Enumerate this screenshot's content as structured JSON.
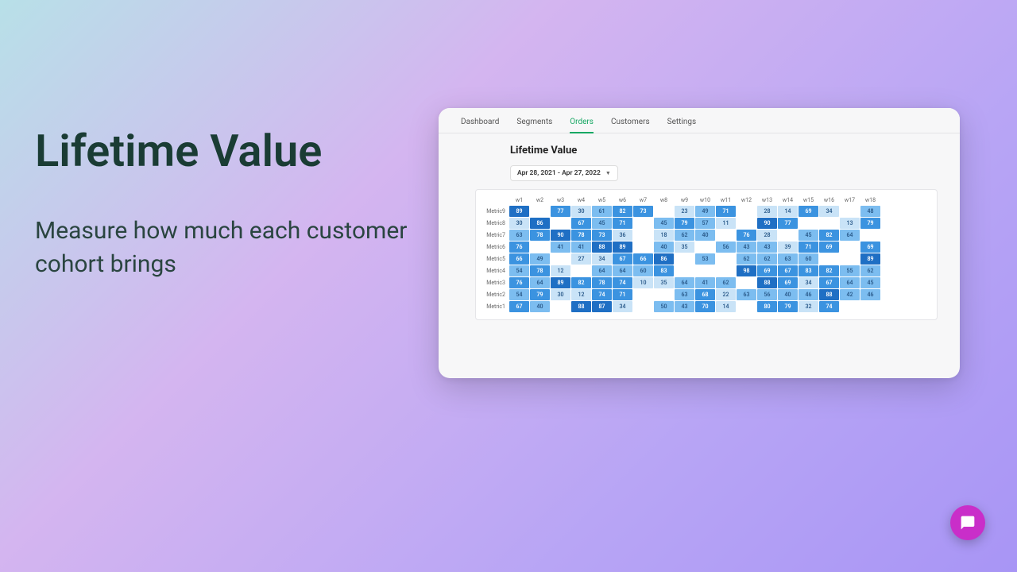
{
  "hero": {
    "title": "Lifetime Value",
    "subtitle": "Measure how much each customer cohort brings"
  },
  "tabs": [
    "Dashboard",
    "Segments",
    "Orders",
    "Customers",
    "Settings"
  ],
  "active_tab_index": 2,
  "page": {
    "title": "Lifetime Value",
    "date_range": "Apr 28, 2021 - Apr 27, 2022"
  },
  "chart_data": {
    "type": "heatmap",
    "title": "Lifetime Value",
    "xlabel": "",
    "ylabel": "",
    "columns": [
      "w1",
      "w2",
      "w3",
      "w4",
      "w5",
      "w6",
      "w7",
      "w8",
      "w9",
      "w10",
      "w11",
      "w12",
      "w13",
      "w14",
      "w15",
      "w16",
      "w17",
      "w18"
    ],
    "rows": [
      "Metric9",
      "Metric8",
      "Metric7",
      "Metric6",
      "Metric5",
      "Metric4",
      "Metric3",
      "Metric2",
      "Metric1"
    ],
    "values": [
      [
        89,
        null,
        77,
        30,
        61,
        82,
        73,
        null,
        23,
        49,
        71,
        null,
        28,
        14,
        69,
        34,
        null,
        48
      ],
      [
        30,
        86,
        null,
        67,
        45,
        71,
        null,
        45,
        79,
        57,
        11,
        null,
        90,
        77,
        null,
        null,
        13,
        79
      ],
      [
        63,
        78,
        90,
        78,
        73,
        36,
        null,
        18,
        62,
        40,
        null,
        76,
        28,
        null,
        45,
        82,
        64,
        null
      ],
      [
        76,
        null,
        41,
        41,
        88,
        89,
        null,
        40,
        35,
        null,
        56,
        43,
        43,
        39,
        71,
        69,
        null,
        69
      ],
      [
        66,
        49,
        null,
        27,
        34,
        67,
        66,
        86,
        null,
        53,
        null,
        62,
        62,
        63,
        60,
        null,
        null,
        89
      ],
      [
        54,
        78,
        12,
        null,
        64,
        64,
        60,
        83,
        null,
        null,
        null,
        98,
        69,
        67,
        83,
        82,
        55,
        62
      ],
      [
        76,
        64,
        89,
        82,
        78,
        74,
        10,
        35,
        64,
        41,
        62,
        null,
        88,
        69,
        34,
        67,
        64,
        45
      ],
      [
        54,
        79,
        30,
        12,
        74,
        71,
        null,
        null,
        63,
        68,
        22,
        63,
        56,
        40,
        46,
        88,
        42,
        46
      ],
      [
        67,
        40,
        null,
        88,
        87,
        34,
        null,
        50,
        43,
        70,
        14,
        null,
        80,
        79,
        32,
        74,
        null,
        null
      ]
    ],
    "color_scale": {
      "null": "#ffffff",
      "low": "#c9e3f7",
      "mid": "#7cbdf0",
      "high": "#3b93e0",
      "max": "#1f6fc4"
    }
  },
  "chat": {
    "label": "chat"
  }
}
